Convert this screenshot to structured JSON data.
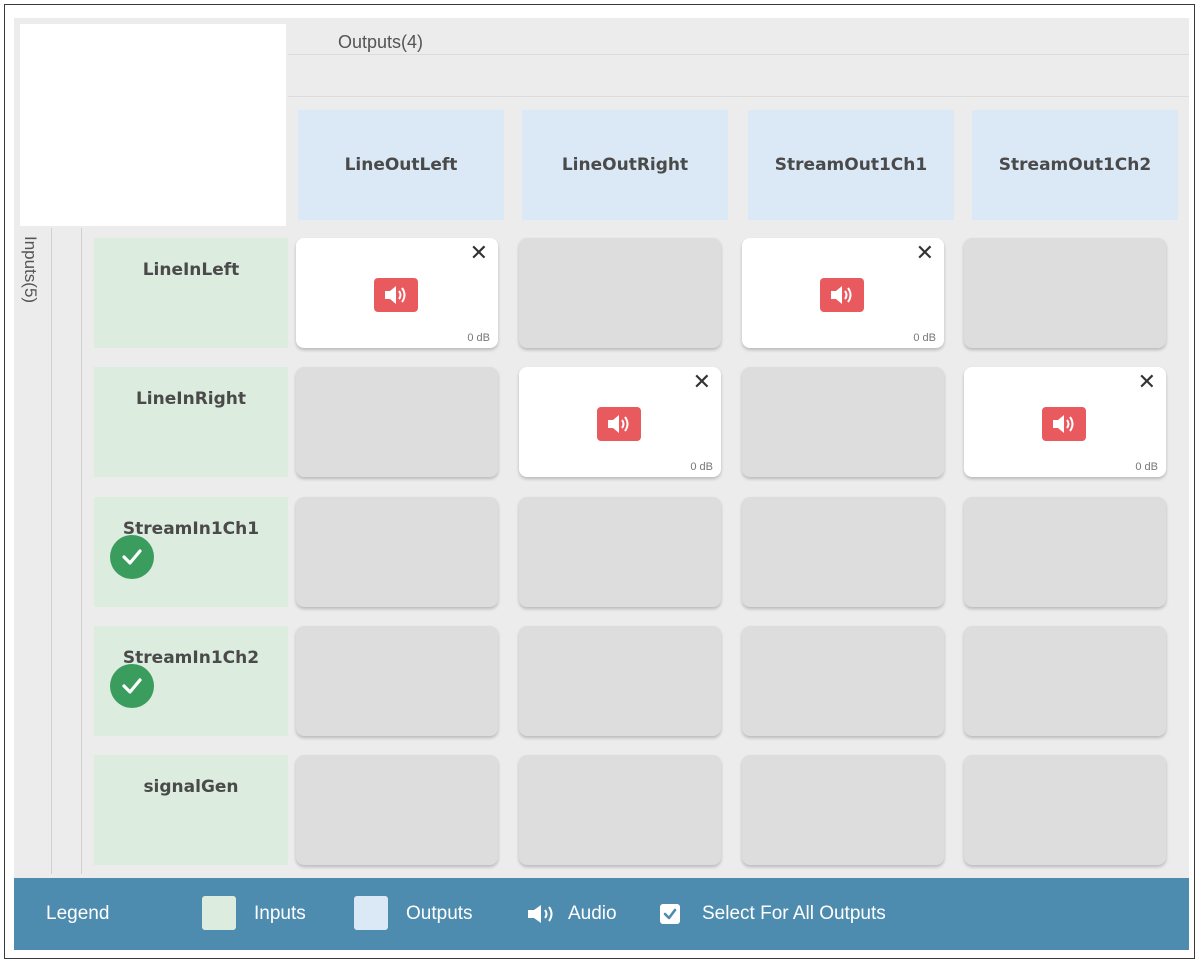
{
  "outputs": {
    "title": "Outputs(4)",
    "columns": [
      "LineOutLeft",
      "LineOutRight",
      "StreamOut1Ch1",
      "StreamOut1Ch2"
    ]
  },
  "inputs": {
    "title": "Inputs(5)",
    "rows": [
      {
        "label": "LineInLeft",
        "select_all": false
      },
      {
        "label": "LineInRight",
        "select_all": false
      },
      {
        "label": "StreamIn1Ch1",
        "select_all": true
      },
      {
        "label": "StreamIn1Ch2",
        "select_all": true
      },
      {
        "label": "signalGen",
        "select_all": false
      }
    ]
  },
  "matrix": [
    [
      true,
      false,
      true,
      false
    ],
    [
      false,
      true,
      false,
      true
    ],
    [
      false,
      false,
      false,
      false
    ],
    [
      false,
      false,
      false,
      false
    ],
    [
      false,
      false,
      false,
      false
    ]
  ],
  "cell": {
    "close_glyph": "✕",
    "gain": "0 dB"
  },
  "legend": {
    "title": "Legend",
    "inputs": "Inputs",
    "outputs": "Outputs",
    "audio": "Audio",
    "select_all": "Select For All Outputs"
  },
  "colors": {
    "input_bg": "#dcecdf",
    "output_bg": "#dbe9f6",
    "audio_icon": "#e85a5e",
    "check": "#3a9d5d",
    "legend_bg": "#4e8caf"
  },
  "icons": {
    "audio": "speaker-icon",
    "close": "close-icon",
    "select_all": "checkmark-icon"
  }
}
